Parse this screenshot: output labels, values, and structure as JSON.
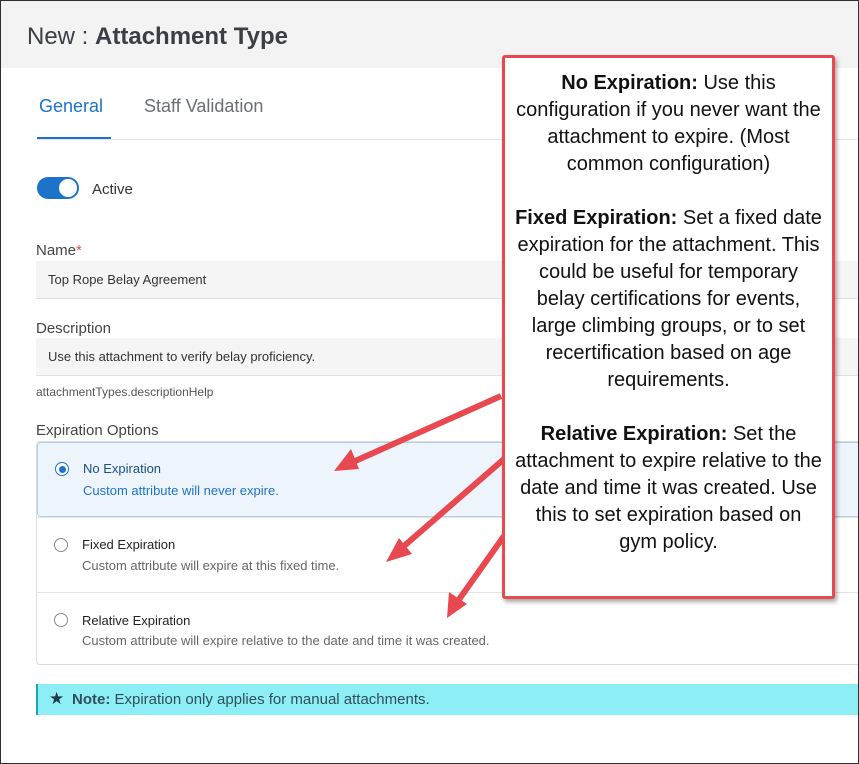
{
  "header": {
    "prefix": "New :",
    "title": "Attachment Type"
  },
  "tabs": [
    {
      "label": "General",
      "active": true
    },
    {
      "label": "Staff Validation",
      "active": false
    }
  ],
  "active_toggle": {
    "label": "Active",
    "on": true
  },
  "name_field": {
    "label": "Name",
    "required_mark": "*",
    "value": "Top Rope Belay Agreement"
  },
  "description_field": {
    "label": "Description",
    "value": "Use this attachment to verify belay proficiency.",
    "help": "attachmentTypes.descriptionHelp"
  },
  "expiration": {
    "label": "Expiration Options",
    "options": [
      {
        "title": "No Expiration",
        "desc": "Custom attribute will never expire.",
        "selected": true
      },
      {
        "title": "Fixed Expiration",
        "desc": "Custom attribute will expire at this fixed time.",
        "selected": false
      },
      {
        "title": "Relative Expiration",
        "desc": "Custom attribute will expire relative to the date and time it was created.",
        "selected": false
      }
    ]
  },
  "note": {
    "icon": "star-icon",
    "label": "Note:",
    "text": "Expiration only applies for manual attachments."
  },
  "callout": {
    "items": [
      {
        "heading": "No Expiration:",
        "body": "Use this configuration if you never want the attachment to expire. (Most common configuration)"
      },
      {
        "heading": "Fixed Expiration:",
        "body": "Set a fixed date expiration for the attachment. This could be useful for temporary belay certifications for events, large climbing groups, or to set recertification based on age requirements."
      },
      {
        "heading": "Relative Expiration:",
        "body": "Set the attachment to expire relative to the date and time it was created. Use this to set expiration based on gym policy."
      }
    ]
  },
  "colors": {
    "primary": "#1c73c9",
    "callout_border": "#e8484f",
    "arrow": "#e8484f",
    "note_bg": "#8deff5"
  }
}
